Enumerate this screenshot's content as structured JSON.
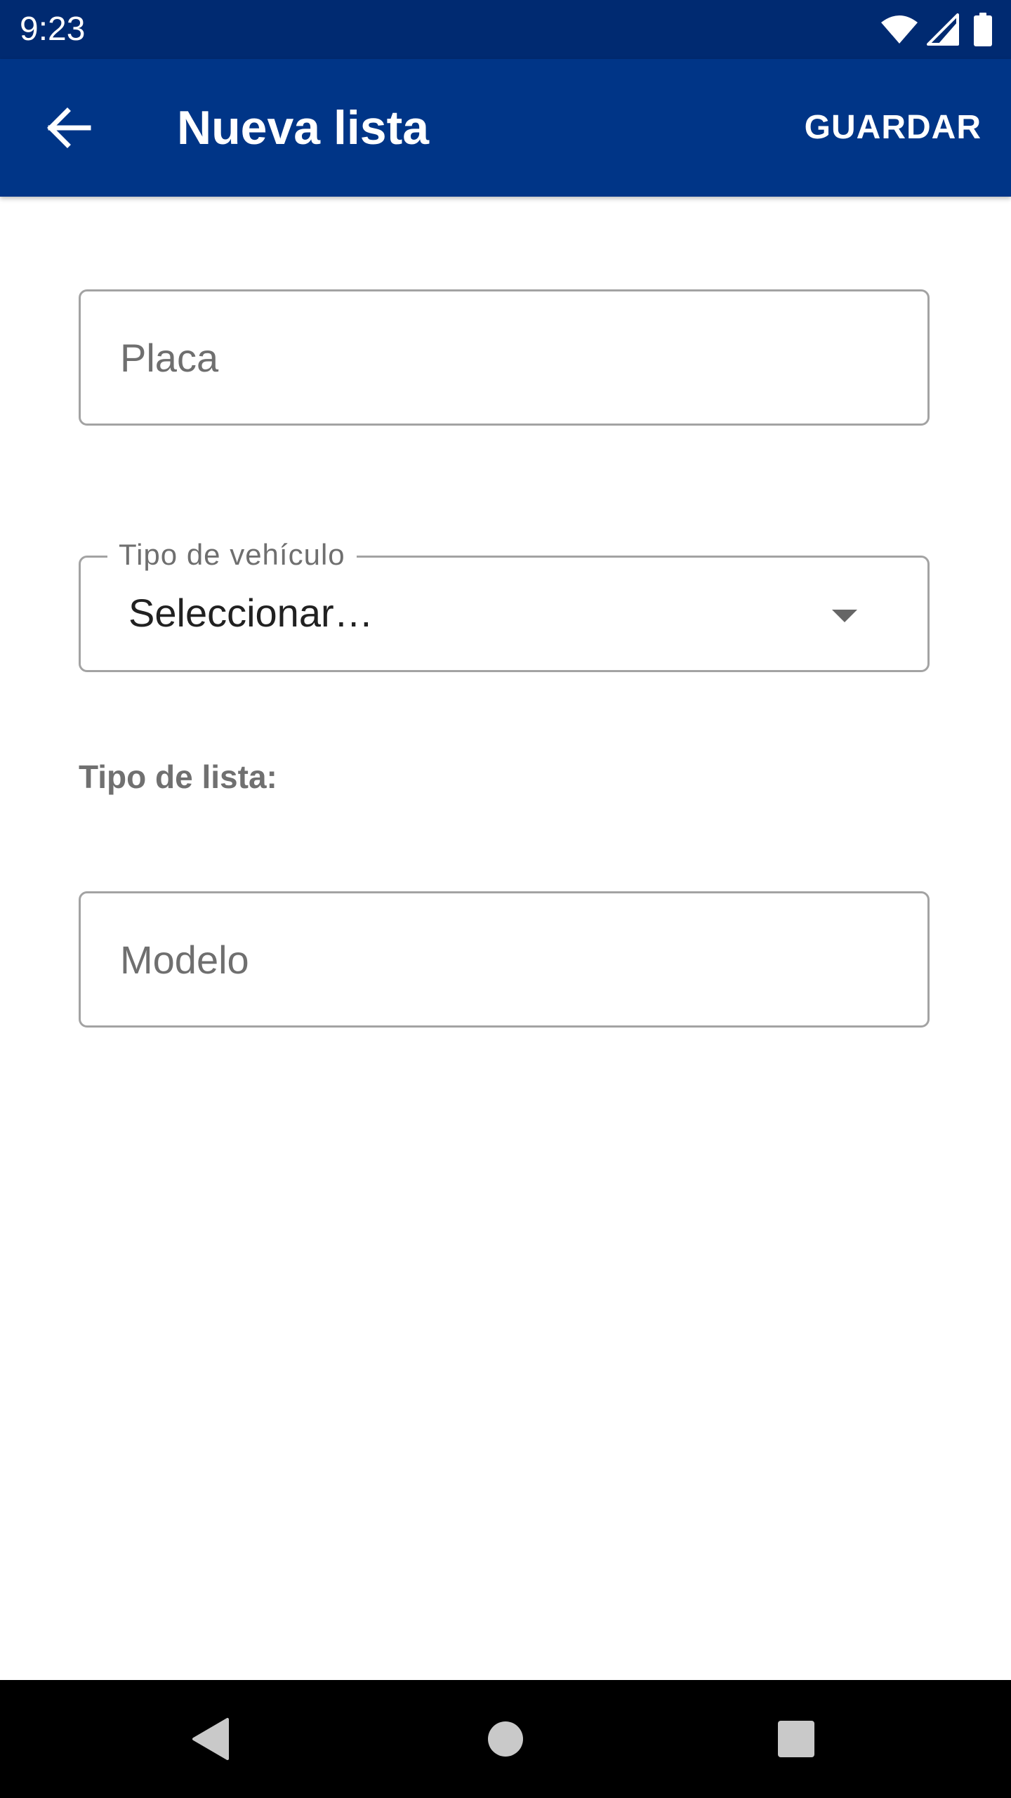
{
  "status_bar": {
    "time": "9:23",
    "icons": [
      "wifi-icon",
      "cell-signal-icon",
      "battery-icon"
    ]
  },
  "app_bar": {
    "title": "Nueva lista",
    "save_label": "GUARDAR",
    "back_icon": "arrow-back-icon"
  },
  "form": {
    "placa": {
      "placeholder": "Placa",
      "value": ""
    },
    "vehicle_type": {
      "label": "Tipo de vehículo",
      "selected": "Seleccionar…",
      "icon": "dropdown-arrow-icon"
    },
    "list_type_label": "Tipo de lista:",
    "modelo": {
      "placeholder": "Modelo",
      "value": ""
    }
  },
  "nav_bar": {
    "icons": [
      "nav-back-icon",
      "nav-home-icon",
      "nav-recents-icon"
    ]
  },
  "colors": {
    "status_bar": "#002a71",
    "app_bar": "#003587",
    "field_border": "#a3a3a3",
    "label_gray": "#707070",
    "nav_bar": "#000000"
  }
}
